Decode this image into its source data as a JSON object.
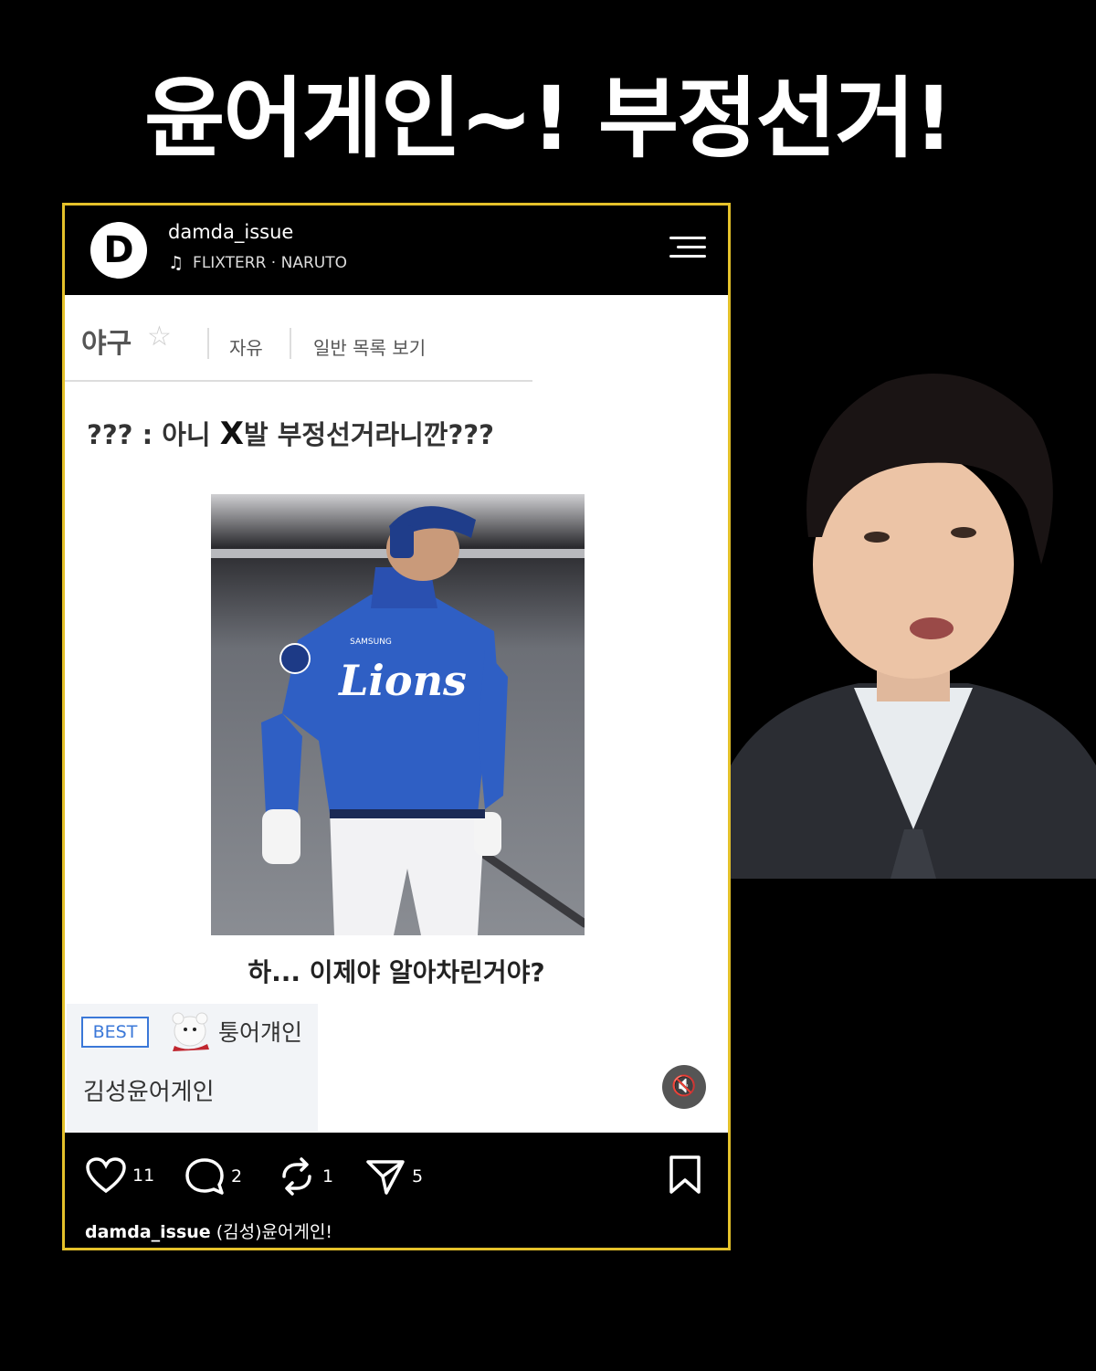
{
  "headline": "윤어게인~! 부정선거!",
  "post": {
    "logo_letter": "D",
    "username": "damda_issue",
    "music": "FLIXTERR · NARUTO",
    "board": {
      "name": "야구",
      "tab_free": "자유",
      "tab_list": "일반 목록 보기"
    },
    "title_prefix": "??? : 아니 ",
    "title_big": "X",
    "title_suffix": "발 부정선거라니깐???",
    "photo": {
      "jersey_text": "Lions",
      "jersey_brand": "SAMSUNG"
    },
    "caption": "하... 이제야 알아차린거야?",
    "comment": {
      "badge": "BEST",
      "author": "퉁어걔인",
      "text": "김성윤어게인"
    },
    "actions": {
      "likes": "11",
      "comments": "2",
      "reposts": "1",
      "shares": "5"
    },
    "footer_user": "damda_issue",
    "footer_text": " (김성)윤어게인!"
  },
  "colors": {
    "frame": "#e4c12a",
    "best_badge": "#3b78d8",
    "jersey": "#2f5fc4"
  }
}
